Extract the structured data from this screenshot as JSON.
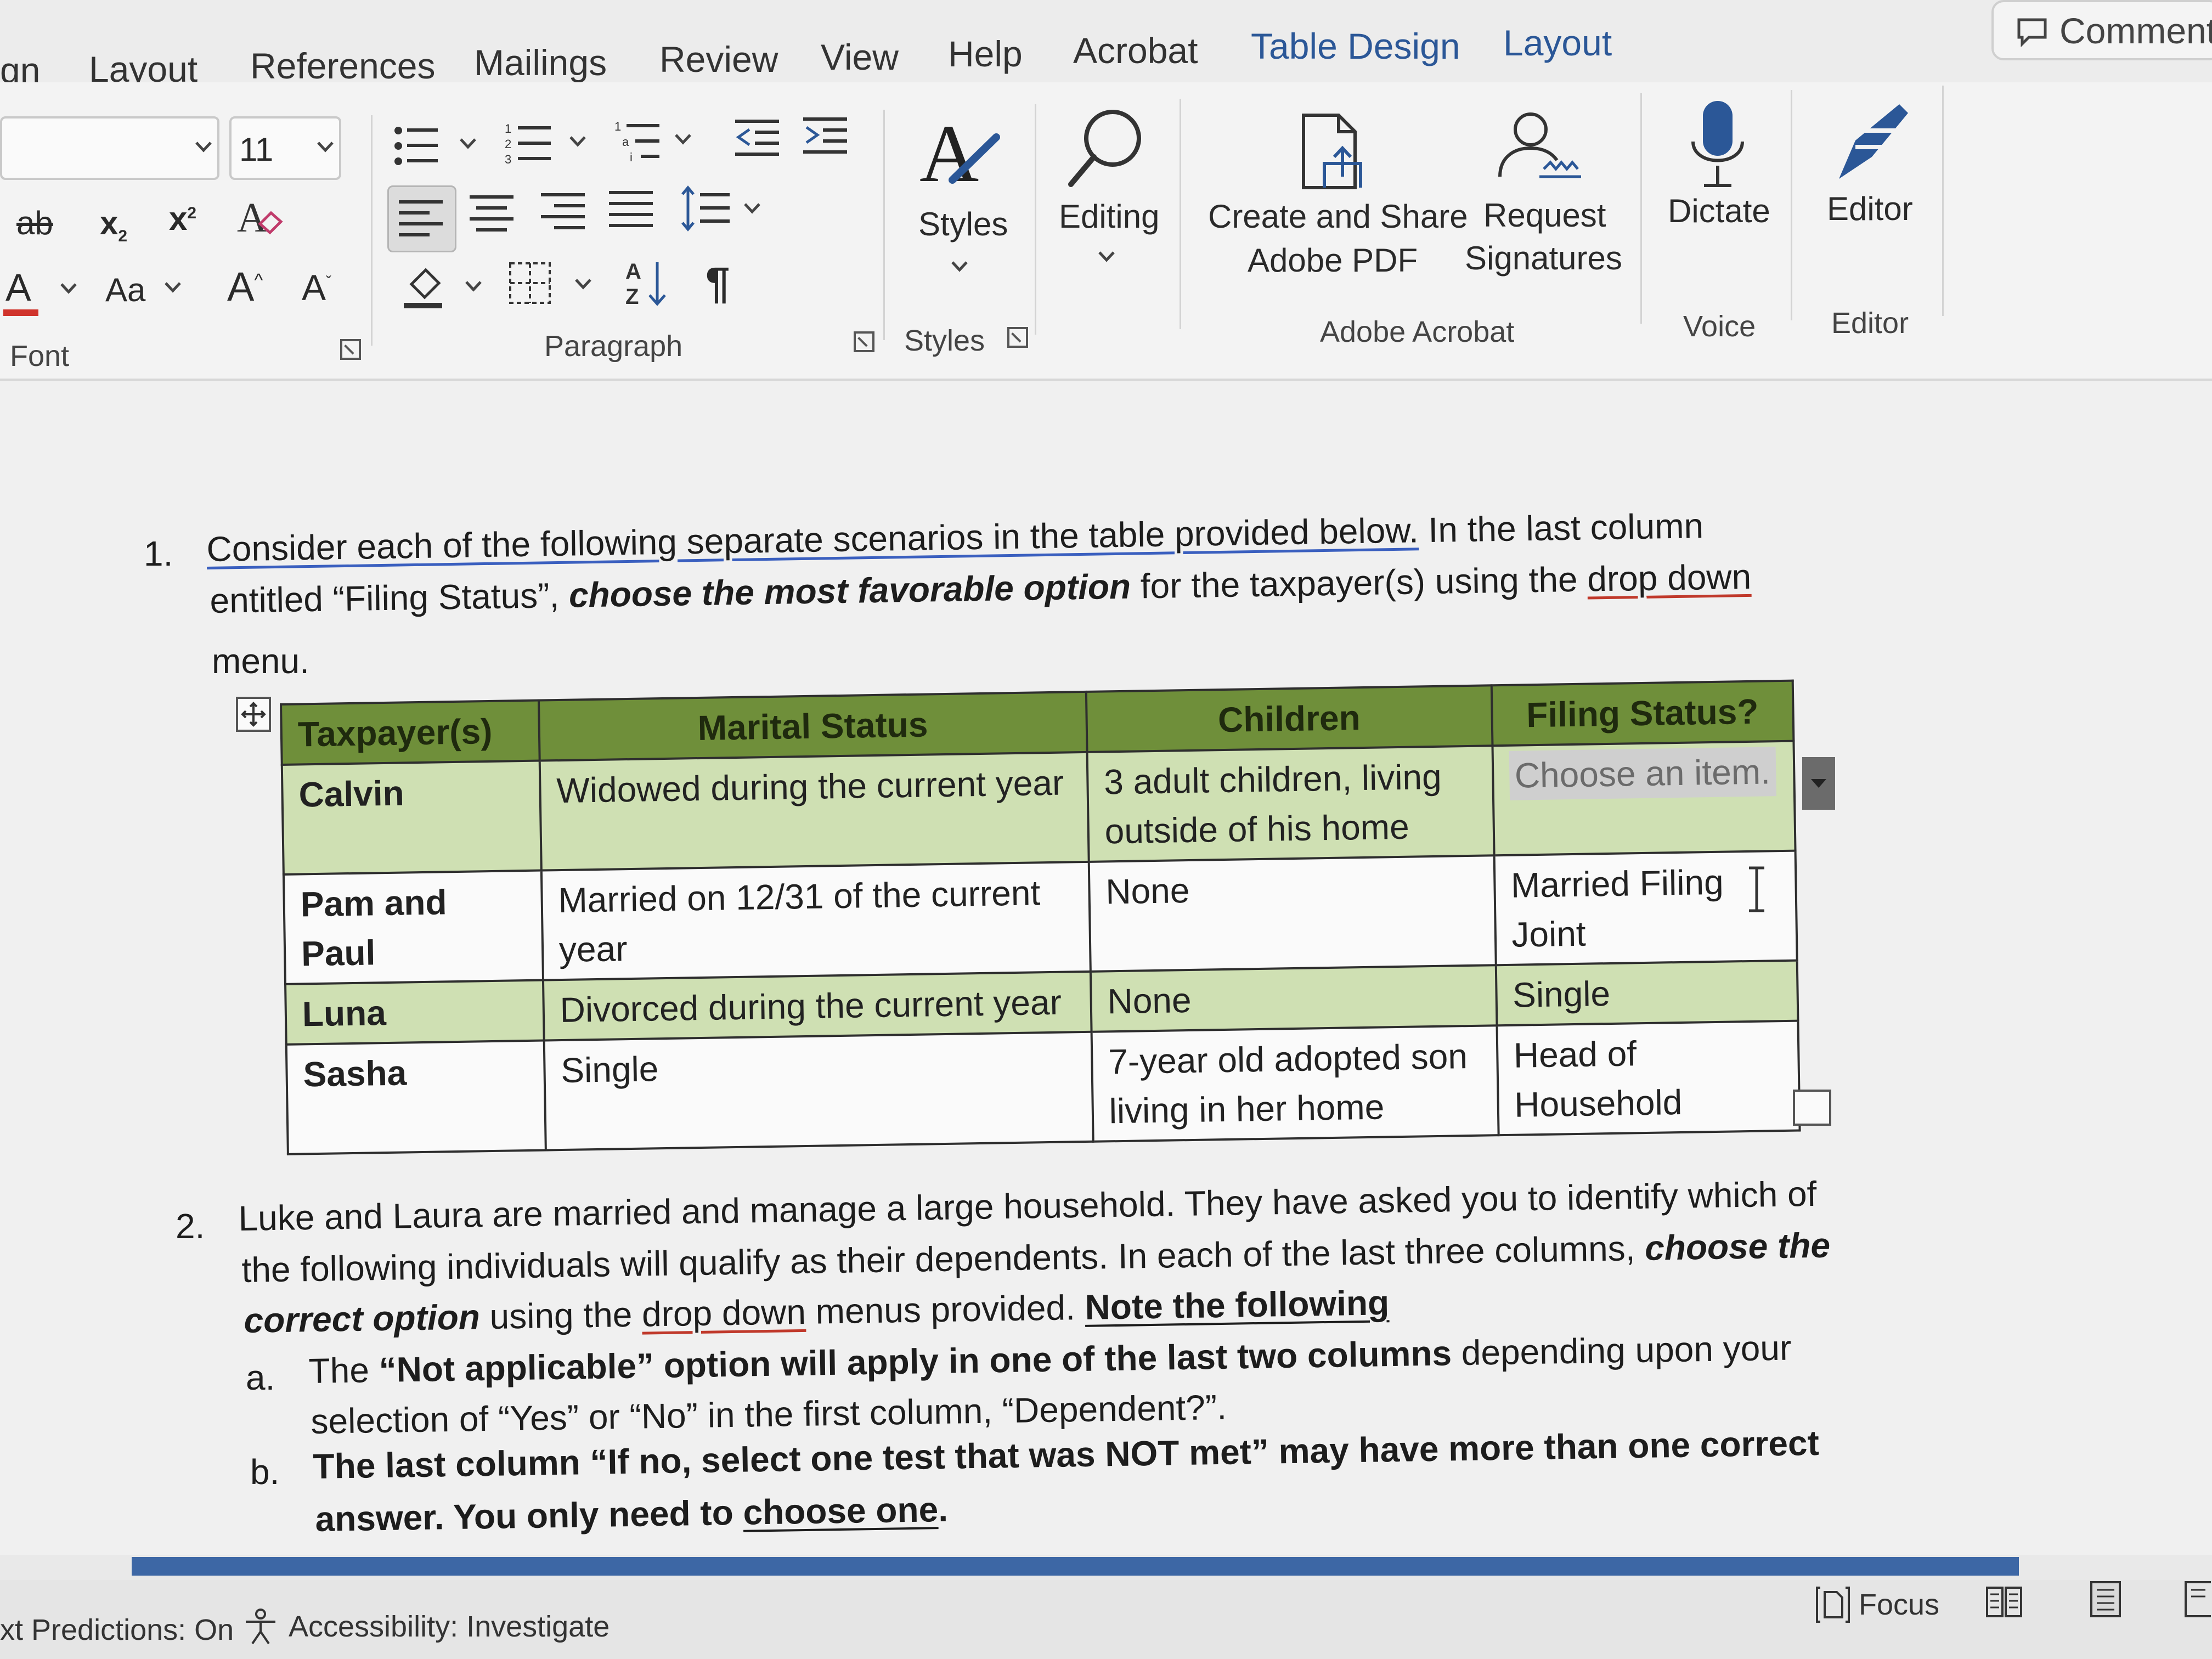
{
  "menu": {
    "tabs": [
      "gn",
      "Layout",
      "References",
      "Mailings",
      "Review",
      "View",
      "Help",
      "Acrobat",
      "Table Design",
      "Layout"
    ],
    "comments_label": "Comments"
  },
  "ribbon": {
    "font_size": "11",
    "font_group_label": "Font",
    "paragraph_group_label": "Paragraph",
    "styles_label": "Styles",
    "styles_group_label": "Styles",
    "editing_label": "Editing",
    "create_share_pdf_line1": "Create and Share",
    "create_share_pdf_line2": "Adobe PDF",
    "request_signatures_line1": "Request",
    "request_signatures_line2": "Signatures",
    "adobe_acrobat_group_label": "Adobe Acrobat",
    "dictate_label": "Dictate",
    "voice_group_label": "Voice",
    "editor_label": "Editor",
    "editor_group_label": "Editor",
    "strike_label": "ab",
    "subscript_label": "x",
    "superscript_label": "x",
    "change_case_label": "Aa",
    "grow_font_label": "A",
    "shrink_font_label": "A",
    "font_color_label": "A",
    "accent_color": "#2b5797"
  },
  "doc": {
    "q1": {
      "number": "1.",
      "line1_a": "Consider each of the following separate scenarios in the table provided below.",
      "line1_b": " In the last column",
      "line2_a": "entitled “Filing Status”, ",
      "line2_b": "choose the most favorable option",
      "line2_c": " for the taxpayer(s) using the ",
      "line2_d": "drop down",
      "line3": "menu."
    },
    "table": {
      "headers": [
        "Taxpayer(s)",
        "Marital Status",
        "Children",
        "Filing Status?"
      ],
      "rows": [
        {
          "taxpayer": "Calvin",
          "marital": "Widowed during the current year",
          "children": "3 adult children, living outside of his home",
          "filing": "Choose an item."
        },
        {
          "taxpayer": "Pam and Paul",
          "marital": "Married on 12/31 of the current year",
          "children": "None",
          "filing": "Married Filing Joint"
        },
        {
          "taxpayer": "Luna",
          "marital": "Divorced during the current year",
          "children": "None",
          "filing": "Single"
        },
        {
          "taxpayer": "Sasha",
          "marital": "Single",
          "children": "7-year old adopted son living in her home",
          "filing": "Head of Household"
        }
      ],
      "header_color": "#6f8f3a",
      "shade_color": "#cfe0b3"
    },
    "q2": {
      "number": "2.",
      "line1": "Luke and Laura are married and manage a large household.  They have asked you to identify which of",
      "line2_a": "the following individuals will qualify as their dependents.  In each of the last three columns, ",
      "line2_b": "choose the",
      "line3_a": "correct option",
      "line3_b": " using the ",
      "line3_c": "drop down",
      "line3_d": " menus provided.  ",
      "line3_e": "Note the following",
      "a_letter": "a.",
      "a_line1_a": "The ",
      "a_line1_b": "“Not applicable” option will apply in one of the last two columns",
      "a_line1_c": " depending upon your",
      "a_line2": "selection of “Yes” or “No” in the first column, “Dependent?”.",
      "b_letter": "b.",
      "b_line1": "The last column “If no, select one test that was NOT met” may have more than one correct",
      "b_line2_a": "answer.  You only need to ",
      "b_line2_b": "choose one",
      "b_line2_c": "."
    }
  },
  "status": {
    "predictions": "xt Predictions: On",
    "accessibility": "Accessibility: Investigate",
    "focus": "Focus"
  }
}
